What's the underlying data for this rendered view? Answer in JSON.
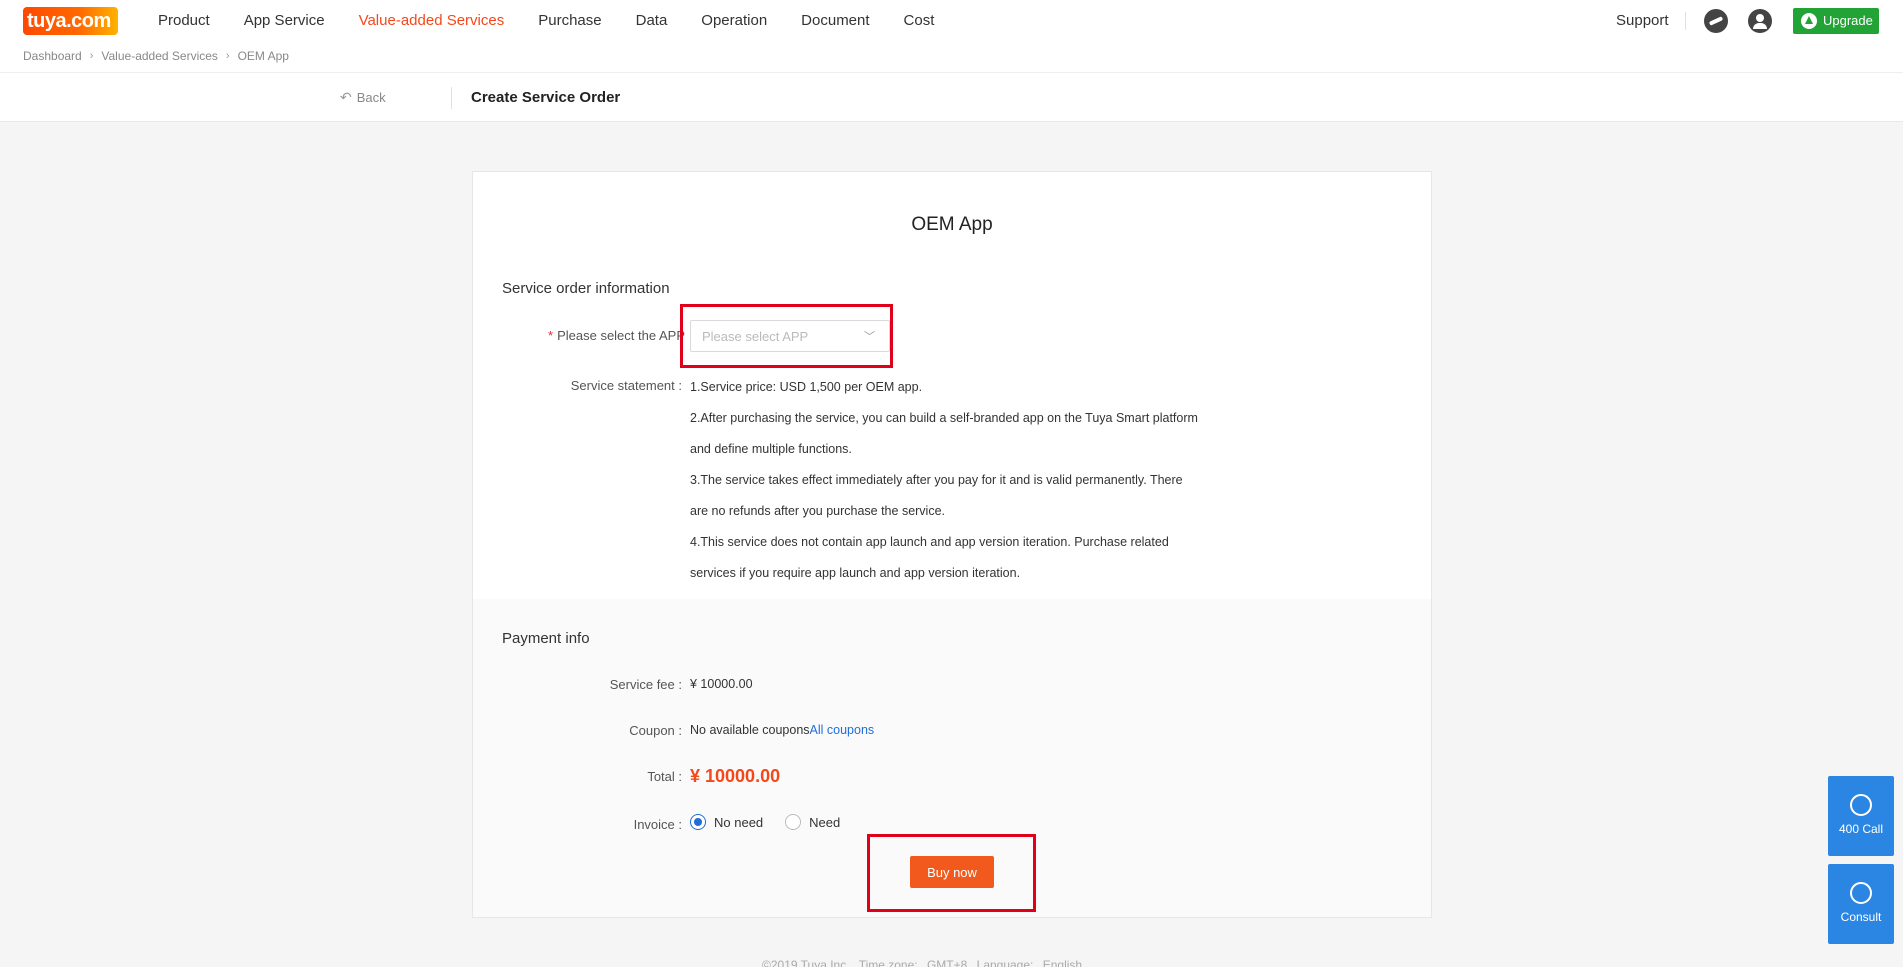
{
  "header": {
    "logo_text": "tuya.com",
    "nav": [
      "Product",
      "App Service",
      "Value-added Services",
      "Purchase",
      "Data",
      "Operation",
      "Document",
      "Cost"
    ],
    "active_nav_index": 2,
    "support_label": "Support",
    "upgrade_label": "Upgrade",
    "accent_color": "#f5481a",
    "upgrade_color": "#21a336"
  },
  "breadcrumb": [
    "Dashboard",
    "Value-added Services",
    "OEM App"
  ],
  "subheader": {
    "back_label": "Back",
    "title": "Create Service Order"
  },
  "card": {
    "title": "OEM App",
    "service_section": "Service order information",
    "select_label": "Please select the APP",
    "select_placeholder": "Please select APP",
    "statement_label": "Service statement :",
    "statement_lines": [
      "1.Service price: USD 1,500 per OEM app.",
      "2.After purchasing the service, you can build a self-branded app on the Tuya Smart platform",
      "and define multiple functions.",
      "3.The service takes effect immediately after you pay for it and is valid permanently. There",
      "are no refunds after you purchase the service.",
      "4.This service does not contain app launch and app version iteration. Purchase related",
      "services if you require app launch and app version iteration."
    ],
    "payment_section": "Payment info",
    "service_fee_label": "Service fee :",
    "service_fee_value": "¥ 10000.00",
    "coupon_label": "Coupon :",
    "coupon_value": "No available coupons",
    "coupon_link": "All coupons",
    "total_label": "Total :",
    "total_value": "¥ 10000.00",
    "invoice_label": "Invoice :",
    "invoice_options": [
      "No need",
      "Need"
    ],
    "invoice_selected": "No need",
    "buy_label": "Buy now"
  },
  "footer": {
    "copyright": "©2019 Tuya Inc.",
    "timezone_label": "Time zone:",
    "timezone_value": "GMT+8",
    "language_label": "Language:",
    "language_value": "English"
  },
  "float": {
    "call_label": "400 Call",
    "consult_label": "Consult"
  }
}
